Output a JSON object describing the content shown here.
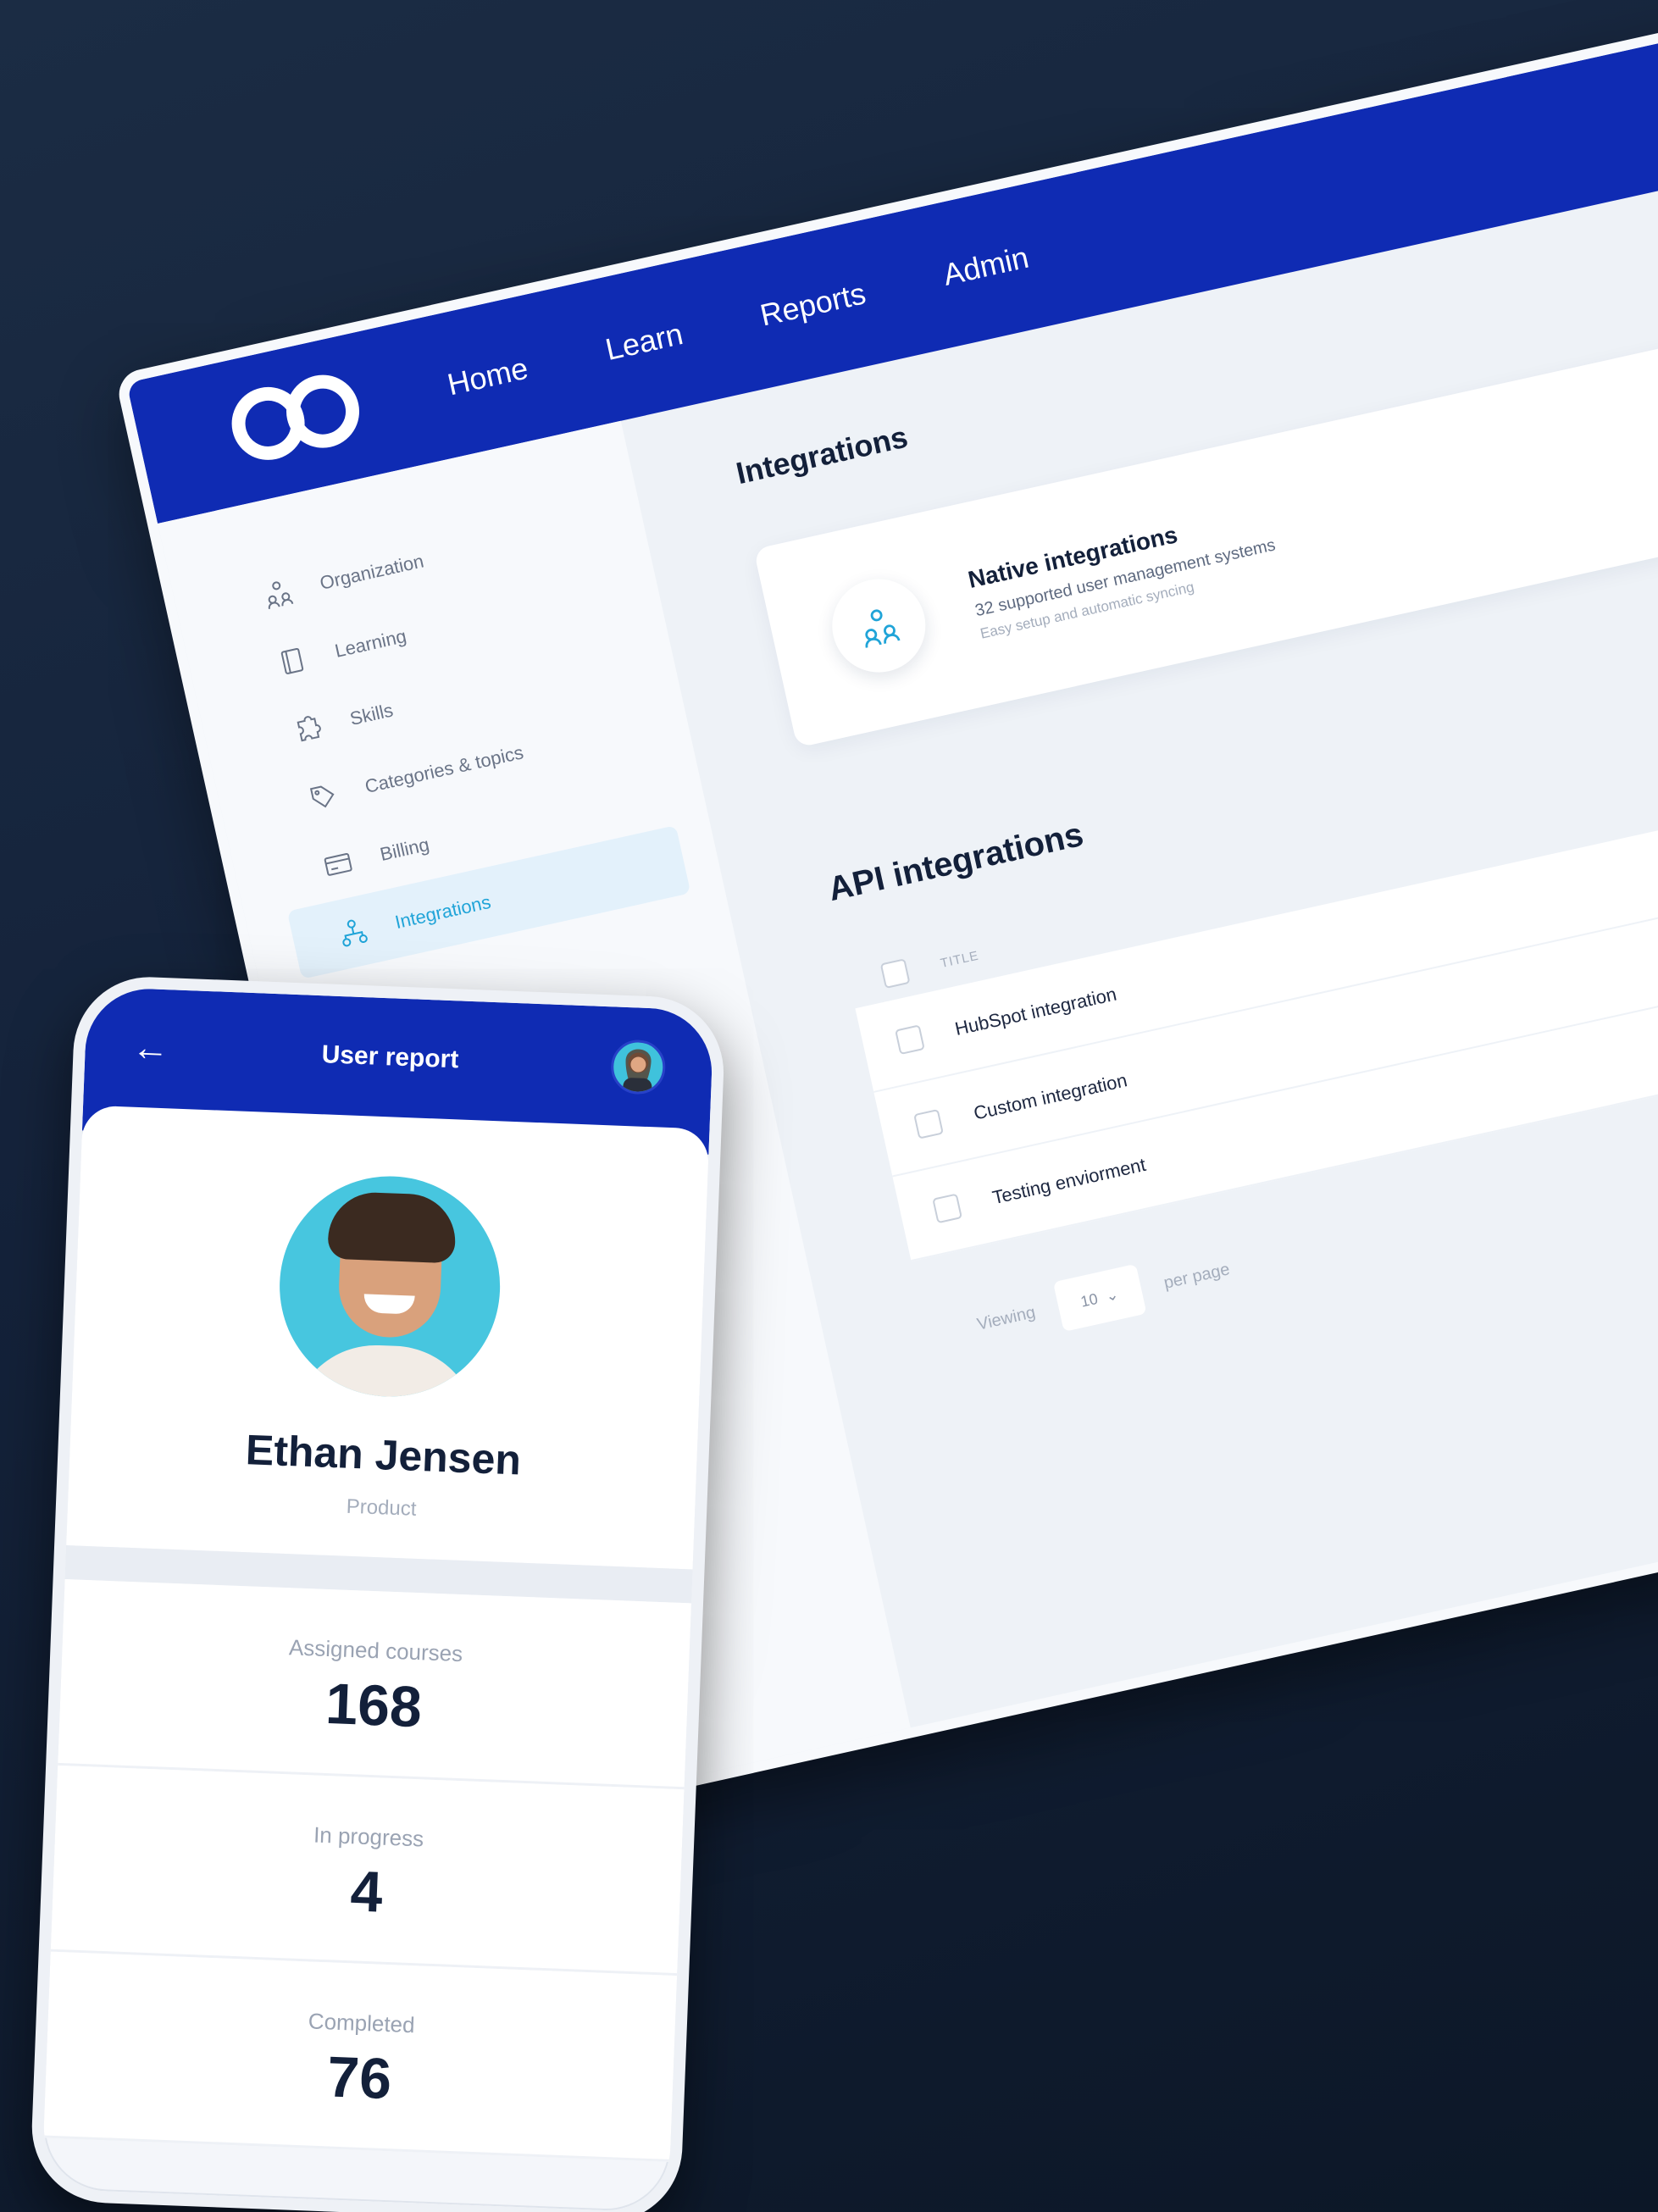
{
  "desktop": {
    "nav": [
      "Home",
      "Learn",
      "Reports",
      "Admin"
    ],
    "sidebar": [
      {
        "label": "Organization",
        "icon": "organization-icon"
      },
      {
        "label": "Learning",
        "icon": "book-icon"
      },
      {
        "label": "Skills",
        "icon": "puzzle-icon"
      },
      {
        "label": "Categories & topics",
        "icon": "tag-icon"
      },
      {
        "label": "Billing",
        "icon": "billing-icon"
      },
      {
        "label": "Integrations",
        "icon": "integrations-icon",
        "active": true
      }
    ],
    "page_title": "Integrations",
    "native_card": {
      "title": "Native integrations",
      "subtitle": "32 supported user management systems",
      "description": "Easy setup and automatic syncing"
    },
    "api_title": "API integrations",
    "table_header": "TITLE",
    "rows": [
      "HubSpot integration",
      "Custom integration",
      "Testing enviorment"
    ],
    "pager": {
      "prefix": "Viewing",
      "value": "10",
      "suffix": "per page"
    }
  },
  "phone": {
    "title": "User report",
    "user_name": "Ethan Jensen",
    "user_role": "Product",
    "stats": [
      {
        "label": "Assigned courses",
        "value": "168"
      },
      {
        "label": "In progress",
        "value": "4"
      },
      {
        "label": "Completed",
        "value": "76"
      }
    ]
  },
  "colors": {
    "brand_blue": "#0f2bb3",
    "accent_cyan": "#20a4d8",
    "background_dark": "#14223a"
  }
}
